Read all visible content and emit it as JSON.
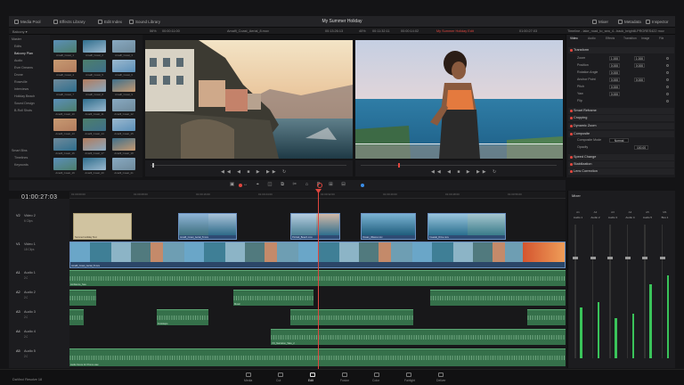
{
  "app": {
    "name": "DaVinci Resolve 18",
    "project_title": "My Summer Holiday"
  },
  "topbar": {
    "left": [
      "Media Pool",
      "Effects Library",
      "Edit Index",
      "Sound Library"
    ],
    "right": [
      "Mixer",
      "Metadata",
      "Inspector"
    ]
  },
  "subbar": {
    "src_zoom": "56%",
    "src_timecode": "00:00:11:00",
    "src_clip": "Amalfi_Coast_Aerial_8.mov",
    "src_tc2": "00:13:26:13",
    "prg_zoom": "40%",
    "prg_tc": "00:11:32:11",
    "prg_tc2": "00:00:14:02",
    "timeline_name": "My Summer Holiday Edit",
    "prg_tc3": "01:00:27:03",
    "inspector_title": "Timeline - lake_road_to_sea_4...back_bright8-PRORES422 mov"
  },
  "media_pool": {
    "tree_header": "Master",
    "tree": [
      "Edits",
      "Balcony Plan",
      "Audio",
      "Ever Dreams",
      "Drone",
      "Roseville",
      "Interviews",
      "Holiday Beach",
      "Sound Design",
      "B-Roll Shots"
    ],
    "selected_index": 1,
    "smart_bins_header": "Smart Bins",
    "smart_bins": [
      "Timelines",
      "Keywords"
    ],
    "breadcrumb": "Balcony ▾",
    "thumb_labels": [
      "Amalfi_Coast_1",
      "Amalfi_Coast_2",
      "Amalfi_Coast_3",
      "Amalfi_Coast_4",
      "Amalfi_Coast_5",
      "Amalfi_Coast_6",
      "Amalfi_Coast_7",
      "Amalfi_Coast_8",
      "Amalfi_Coast_9",
      "Amalfi_Coast_10",
      "Amalfi_Coast_11",
      "Amalfi_Coast_12",
      "Amalfi_Coast_13",
      "Amalfi_Coast_14",
      "Amalfi_Coast_15",
      "Amalfi_Coast_16",
      "Amalfi_Coast_17",
      "Amalfi_Coast_18",
      "Amalfi_Coast_19",
      "Amalfi_Coast_20",
      "Amalfi_Coast_21"
    ]
  },
  "inspector": {
    "tabs": [
      "Video",
      "Audio",
      "Effects",
      "Transition",
      "Image",
      "File"
    ],
    "transform": "Transform",
    "rows": [
      {
        "label": "Zoom",
        "x": "1.000",
        "y": "1.000"
      },
      {
        "label": "Position",
        "x": "0.000",
        "y": "0.000"
      },
      {
        "label": "Rotation Angle",
        "x": "0.000",
        "y": ""
      },
      {
        "label": "Anchor Point",
        "x": "0.000",
        "y": "0.000"
      },
      {
        "label": "Pitch",
        "x": "0.000",
        "y": ""
      },
      {
        "label": "Yaw",
        "x": "0.000",
        "y": ""
      },
      {
        "label": "Flip",
        "x": "",
        "y": ""
      }
    ],
    "sections": [
      "Smart Reframe",
      "Cropping",
      "Dynamic Zoom",
      "Composite",
      "Speed Change",
      "Stabilization",
      "Lens Correction"
    ],
    "composite_mode_label": "Composite Mode",
    "composite_mode_value": "Normal",
    "opacity_label": "Opacity",
    "opacity_value": "100.00"
  },
  "timeline": {
    "timecode": "01:00:27:03",
    "ruler_ticks": [
      "01:00:00:00",
      "01:00:08:00",
      "01:00:16:00",
      "01:00:24:00",
      "01:00:32:00",
      "01:00:40:00",
      "01:00:48:00",
      "01:00:56:00"
    ],
    "tracks": [
      {
        "tag": "V2",
        "name": "Video 2",
        "info": "6 Clips"
      },
      {
        "tag": "V1",
        "name": "Video 1",
        "info": "18 Clips"
      },
      {
        "tag": "A1",
        "name": "Audio 1",
        "info": "2.0"
      },
      {
        "tag": "A2",
        "name": "Audio 2",
        "info": "2.0"
      },
      {
        "tag": "A3",
        "name": "Audio 3",
        "info": "2.0"
      },
      {
        "tag": "A4",
        "name": "Audio 4",
        "info": "2.0"
      },
      {
        "tag": "A5",
        "name": "Audio 5",
        "info": "2.0"
      }
    ],
    "clip_names": {
      "v2_title": "Summer Holiday Text",
      "v2_a": "Amalfi_Coast_Aerial_8.mov",
      "v2_b": "Portrait_Beach.mov",
      "v2_c": "Ocean_Waves.mov",
      "v2_d": "Coastal_Drive.mov",
      "v1": "Amalfi_Coast_Aerial_8.mov",
      "a1": "Ambience_Sea",
      "a2": "Music",
      "a3": "Footsteps",
      "a4": "VO_Narration_Take_2",
      "a5": "Audio Score for Promo.wav"
    }
  },
  "mixer": {
    "title": "Mixer",
    "channels": [
      "A1",
      "A2",
      "A3",
      "A4",
      "A5",
      "M1"
    ],
    "channel_names": [
      "Audio 1",
      "Audio 2",
      "Audio 3",
      "Audio 4",
      "Audio 5",
      "Bus 1"
    ],
    "levels": [
      0.38,
      0.42,
      0.3,
      0.33,
      0.55,
      0.62
    ]
  },
  "pages": {
    "items": [
      "Media",
      "Cut",
      "Edit",
      "Fusion",
      "Color",
      "Fairlight",
      "Deliver"
    ],
    "selected_index": 2
  },
  "colors": {
    "accent_red": "#e0463e",
    "video_clip": "#2e4b73",
    "audio_clip": "#35704a",
    "meter_green": "#3ac35a"
  }
}
